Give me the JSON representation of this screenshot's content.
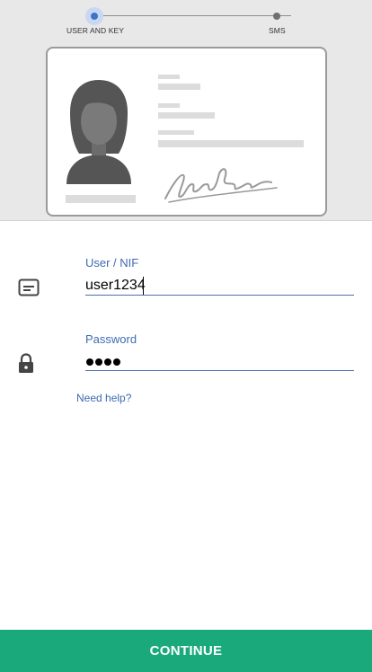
{
  "stepper": {
    "steps": [
      {
        "label": "USER AND KEY",
        "active": true
      },
      {
        "label": "SMS",
        "active": false
      }
    ],
    "active_color": "#3f74c8"
  },
  "illustration": {
    "icons": [
      "avatar-icon",
      "signature-icon"
    ]
  },
  "form": {
    "user": {
      "label": "User / NIF",
      "value": "user1234",
      "icon": "id-card-icon"
    },
    "password": {
      "label": "Password",
      "masked_length": 4,
      "icon": "lock-icon"
    },
    "help_link": "Need help?"
  },
  "continue_label": "CONTINUE",
  "colors": {
    "primary_button": "#1aa97a",
    "link": "#3f6bb1"
  }
}
